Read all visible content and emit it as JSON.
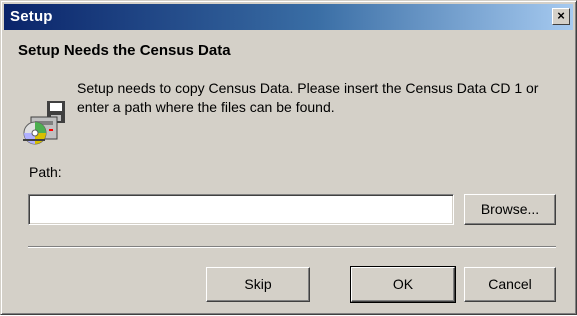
{
  "window": {
    "title": "Setup",
    "close_glyph": "×",
    "titlebar_colors": [
      "#0a246a",
      "#a6caf0"
    ],
    "face_color": "#d4d0c8"
  },
  "content": {
    "heading": "Setup Needs the Census Data",
    "message": "Setup needs to copy Census Data.  Please insert the Census Data CD 1 or enter a path where the files can be found.",
    "icon": "setup-disk-cd-icon"
  },
  "path": {
    "label": "Path:",
    "value": "",
    "placeholder": ""
  },
  "buttons": {
    "browse": "Browse...",
    "skip": "Skip",
    "ok": "OK",
    "cancel": "Cancel"
  }
}
